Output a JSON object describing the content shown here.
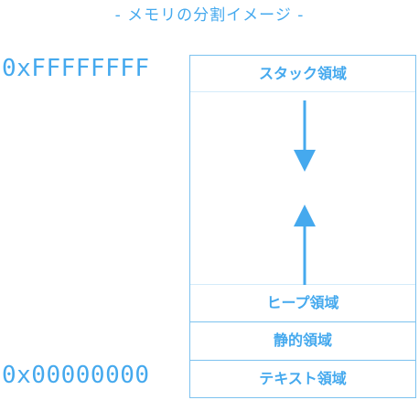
{
  "title": "- メモリの分割イメージ -",
  "addresses": {
    "high": "0xFFFFFFFF",
    "low": "0x00000000"
  },
  "regions": {
    "stack": "スタック領域",
    "heap": "ヒープ領域",
    "static": "静的領域",
    "text": "テキスト領域"
  },
  "arrows": {
    "stack_growth": "down",
    "heap_growth": "up"
  },
  "colors": {
    "accent": "#45a9ee",
    "border": "#7cc2ef",
    "divider": "#d4ebfa"
  }
}
